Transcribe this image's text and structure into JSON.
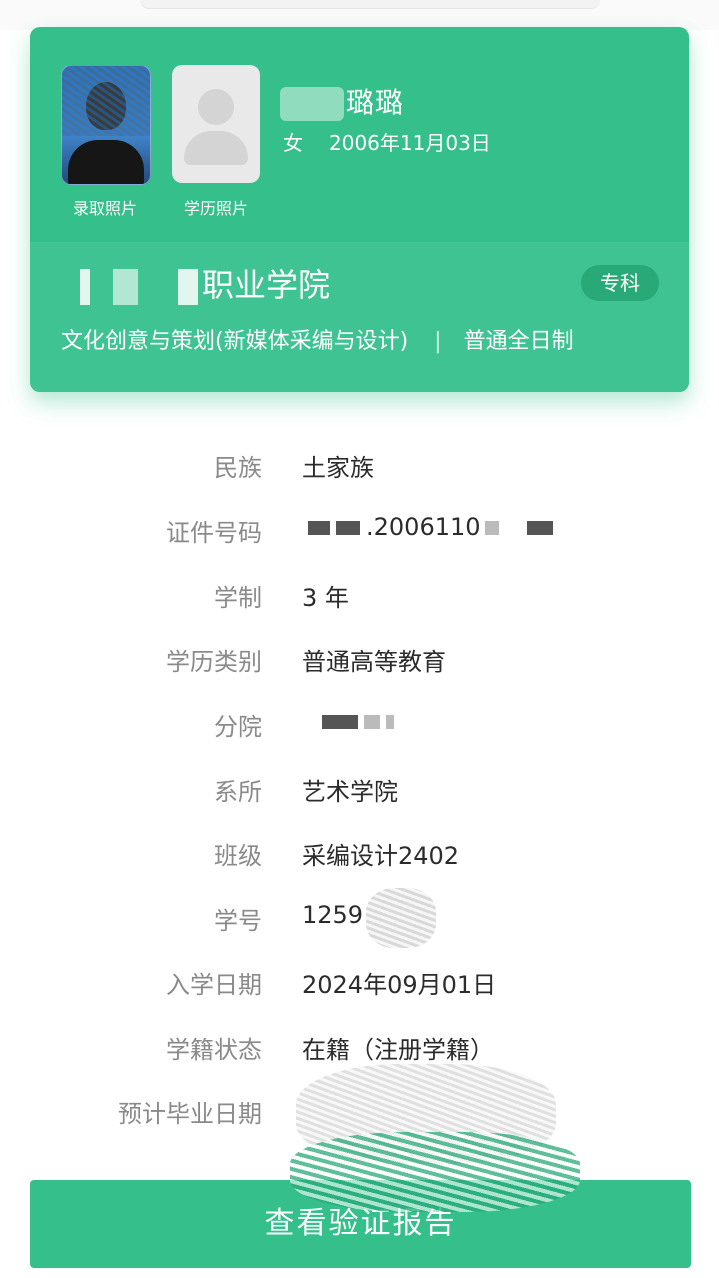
{
  "card": {
    "photos": [
      {
        "label": "录取照片"
      },
      {
        "label": "学历照片"
      }
    ],
    "name_visible": "璐璐",
    "gender": "女",
    "birth_date": "2006年11月03日",
    "school_visible": "职业学院",
    "level": "专科",
    "major": "文化创意与策划(新媒体采编与设计)",
    "separator": "|",
    "study_mode": "普通全日制"
  },
  "info": {
    "rows": [
      {
        "label": "民族",
        "value": "土家族"
      },
      {
        "label": "证件号码",
        "value": ".2006110"
      },
      {
        "label": "学制",
        "value": "3 年"
      },
      {
        "label": "学历类别",
        "value": "普通高等教育"
      },
      {
        "label": "分院",
        "value": ""
      },
      {
        "label": "系所",
        "value": "艺术学院"
      },
      {
        "label": "班级",
        "value": "采编设计2402"
      },
      {
        "label": "学号",
        "value": "1259"
      },
      {
        "label": "入学日期",
        "value": "2024年09月01日"
      },
      {
        "label": "学籍状态",
        "value": "在籍（注册学籍）"
      },
      {
        "label": "预计毕业日期",
        "value": ""
      }
    ]
  },
  "actions": {
    "verify_report": "查看验证报告"
  },
  "colors": {
    "accent": "#34bf8b",
    "badge": "#2aa978",
    "label": "#8a8a8a",
    "value": "#2b2b2b"
  }
}
